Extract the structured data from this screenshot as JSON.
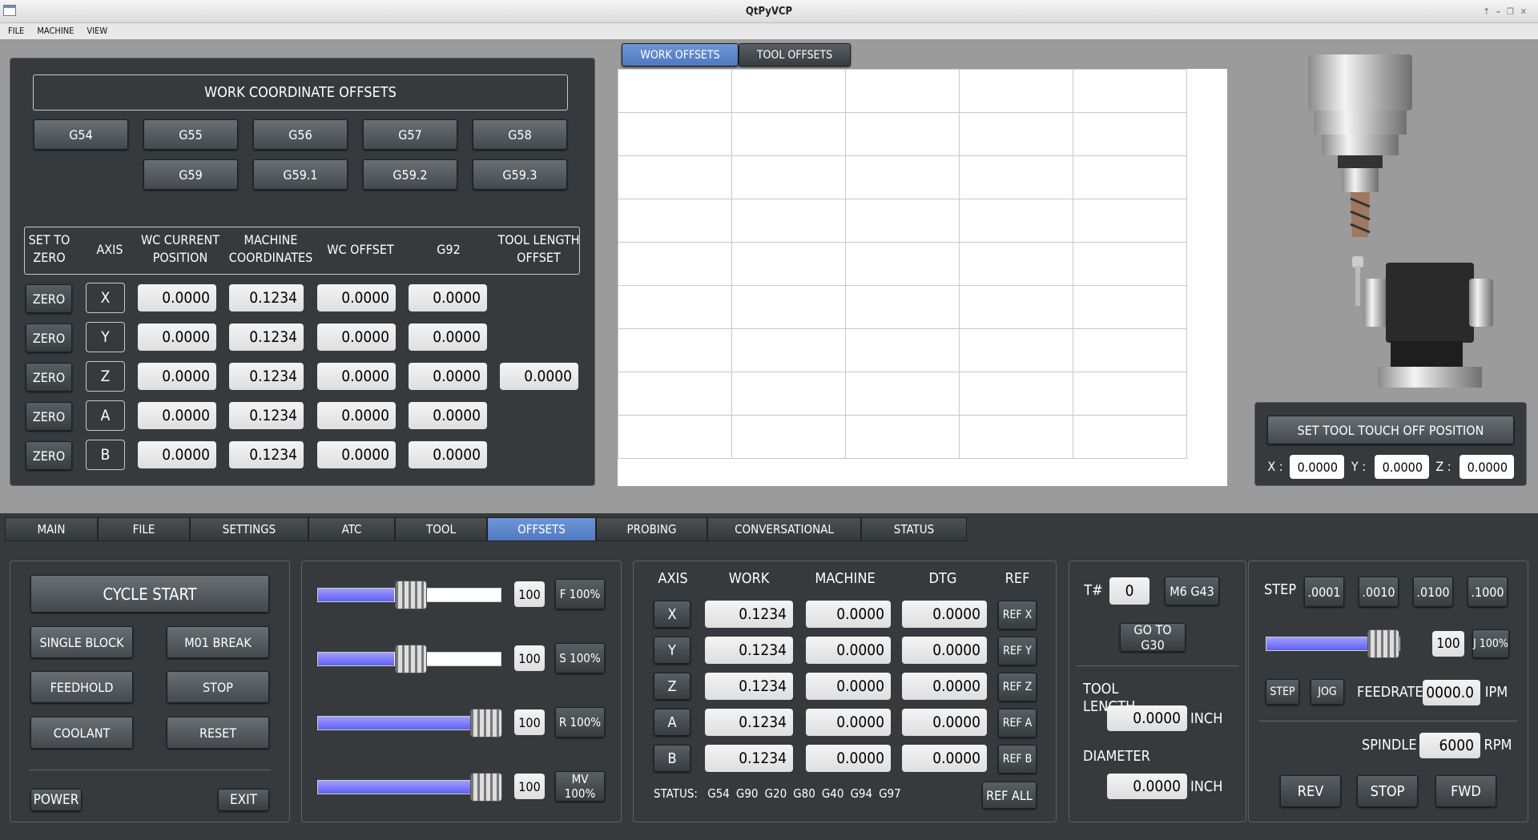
{
  "window": {
    "title": "QtPyVCP"
  },
  "menu": [
    "FILE",
    "MACHINE",
    "VIEW"
  ],
  "offset_tabs": [
    {
      "label": "WORK OFFSETS",
      "active": true
    },
    {
      "label": "TOOL OFFSETS",
      "active": false
    }
  ],
  "wco": {
    "title": "WORK COORDINATE OFFSETS",
    "row1": [
      "G54",
      "G55",
      "G56",
      "G57",
      "G58"
    ],
    "row2": [
      "G59",
      "G59.1",
      "G59.2",
      "G59.3"
    ],
    "headers": [
      "SET TO\nZERO",
      "AXIS",
      "WC CURRENT\nPOSITION",
      "MACHINE\nCOORDINATES",
      "WC OFFSET",
      "G92",
      "TOOL LENGTH\nOFFSET"
    ],
    "zero_label": "ZERO",
    "rows": [
      {
        "axis": "X",
        "wc": "0.0000",
        "mach": "0.1234",
        "off": "0.0000",
        "g92": "0.0000"
      },
      {
        "axis": "Y",
        "wc": "0.0000",
        "mach": "0.1234",
        "off": "0.0000",
        "g92": "0.0000"
      },
      {
        "axis": "Z",
        "wc": "0.0000",
        "mach": "0.1234",
        "off": "0.0000",
        "g92": "0.0000",
        "tlo": "0.0000"
      },
      {
        "axis": "A",
        "wc": "0.0000",
        "mach": "0.1234",
        "off": "0.0000",
        "g92": "0.0000"
      },
      {
        "axis": "B",
        "wc": "0.0000",
        "mach": "0.1234",
        "off": "0.0000",
        "g92": "0.0000"
      }
    ]
  },
  "touchoff": {
    "button": "SET TOOL TOUCH OFF POSITION",
    "x_label": "X :",
    "x": "0.0000",
    "y_label": "Y :",
    "y": "0.0000",
    "z_label": "Z :",
    "z": "0.0000"
  },
  "main_tabs": [
    {
      "label": "MAIN"
    },
    {
      "label": "FILE"
    },
    {
      "label": "SETTINGS"
    },
    {
      "label": "ATC"
    },
    {
      "label": "TOOL"
    },
    {
      "label": "OFFSETS",
      "active": true
    },
    {
      "label": "PROBING"
    },
    {
      "label": "CONVERSATIONAL"
    },
    {
      "label": "STATUS"
    }
  ],
  "control": {
    "cycle_start": "CYCLE START",
    "single_block": "SINGLE BLOCK",
    "m01_break": "M01 BREAK",
    "feedhold": "FEEDHOLD",
    "stop": "STOP",
    "coolant": "COOLANT",
    "reset": "RESET",
    "power": "POWER",
    "exit": "EXIT"
  },
  "overrides": [
    {
      "value": "100",
      "button": "F 100%",
      "level": 0.5
    },
    {
      "value": "100",
      "button": "S 100%",
      "level": 0.5
    },
    {
      "value": "100",
      "button": "R 100%",
      "level": 1.0
    },
    {
      "value": "100",
      "button": "MV 100%",
      "level": 1.0
    }
  ],
  "dro": {
    "headers": [
      "AXIS",
      "WORK",
      "MACHINE",
      "DTG",
      "REF"
    ],
    "rows": [
      {
        "axis": "X",
        "work": "0.1234",
        "mach": "0.0000",
        "dtg": "0.0000",
        "ref": "REF X"
      },
      {
        "axis": "Y",
        "work": "0.1234",
        "mach": "0.0000",
        "dtg": "0.0000",
        "ref": "REF Y"
      },
      {
        "axis": "Z",
        "work": "0.1234",
        "mach": "0.0000",
        "dtg": "0.0000",
        "ref": "REF Z"
      },
      {
        "axis": "A",
        "work": "0.1234",
        "mach": "0.0000",
        "dtg": "0.0000",
        "ref": "REF A"
      },
      {
        "axis": "B",
        "work": "0.1234",
        "mach": "0.0000",
        "dtg": "0.0000",
        "ref": "REF B"
      }
    ],
    "status_label": "STATUS:",
    "status_codes": [
      "G54",
      "G90",
      "G20",
      "G80",
      "G40",
      "G94",
      "G97"
    ],
    "ref_all": "REF ALL"
  },
  "tool": {
    "t_label": "T#",
    "t_value": "0",
    "m6": "M6 G43",
    "g30": "GO TO G30",
    "length_label": "TOOL LENGTH",
    "length": "0.0000",
    "length_unit": "INCH",
    "diameter_label": "DIAMETER",
    "diameter": "0.0000",
    "diameter_unit": "INCH"
  },
  "jog": {
    "step_label": "STEP",
    "steps": [
      ".0001",
      ".0010",
      ".0100",
      ".1000"
    ],
    "jog_value": "100",
    "jog_level": 1.0,
    "jog_button": "J 100%",
    "step_btn": "STEP",
    "jog_btn": "JOG",
    "feedrate_label": "FEEDRATE",
    "feedrate": "0000.0",
    "feedrate_unit": "IPM",
    "spindle_label": "SPINDLE",
    "spindle": "6000",
    "spindle_unit": "RPM",
    "rev": "REV",
    "stop": "STOP",
    "fwd": "FWD"
  }
}
